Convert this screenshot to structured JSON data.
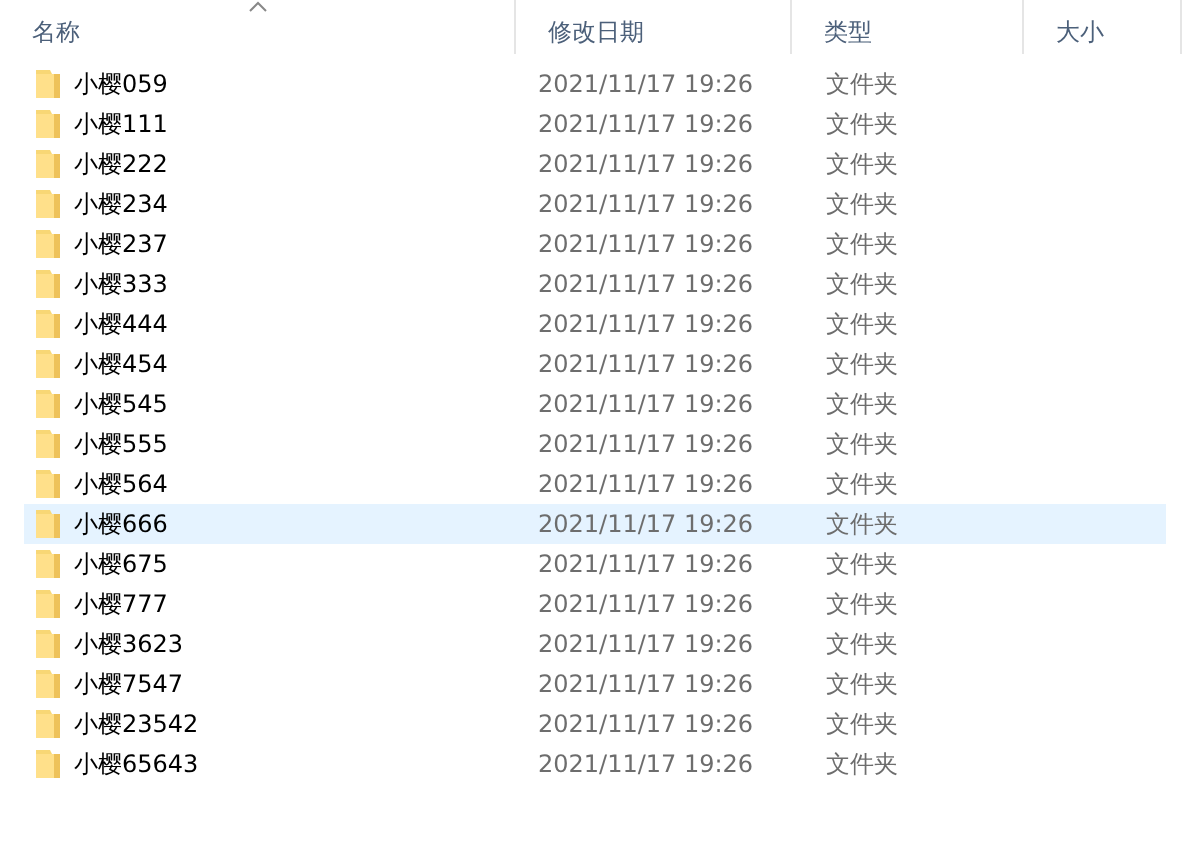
{
  "columns": [
    {
      "label": "名称",
      "sorted": true
    },
    {
      "label": "修改日期",
      "sorted": false
    },
    {
      "label": "类型",
      "sorted": false
    },
    {
      "label": "大小",
      "sorted": false
    }
  ],
  "rows": [
    {
      "name": "小樱059",
      "modified": "2021/11/17 19:26",
      "type": "文件夹",
      "hovered": false
    },
    {
      "name": "小樱111",
      "modified": "2021/11/17 19:26",
      "type": "文件夹",
      "hovered": false
    },
    {
      "name": "小樱222",
      "modified": "2021/11/17 19:26",
      "type": "文件夹",
      "hovered": false
    },
    {
      "name": "小樱234",
      "modified": "2021/11/17 19:26",
      "type": "文件夹",
      "hovered": false
    },
    {
      "name": "小樱237",
      "modified": "2021/11/17 19:26",
      "type": "文件夹",
      "hovered": false
    },
    {
      "name": "小樱333",
      "modified": "2021/11/17 19:26",
      "type": "文件夹",
      "hovered": false
    },
    {
      "name": "小樱444",
      "modified": "2021/11/17 19:26",
      "type": "文件夹",
      "hovered": false
    },
    {
      "name": "小樱454",
      "modified": "2021/11/17 19:26",
      "type": "文件夹",
      "hovered": false
    },
    {
      "name": "小樱545",
      "modified": "2021/11/17 19:26",
      "type": "文件夹",
      "hovered": false
    },
    {
      "name": "小樱555",
      "modified": "2021/11/17 19:26",
      "type": "文件夹",
      "hovered": false
    },
    {
      "name": "小樱564",
      "modified": "2021/11/17 19:26",
      "type": "文件夹",
      "hovered": false
    },
    {
      "name": "小樱666",
      "modified": "2021/11/17 19:26",
      "type": "文件夹",
      "hovered": true
    },
    {
      "name": "小樱675",
      "modified": "2021/11/17 19:26",
      "type": "文件夹",
      "hovered": false
    },
    {
      "name": "小樱777",
      "modified": "2021/11/17 19:26",
      "type": "文件夹",
      "hovered": false
    },
    {
      "name": "小樱3623",
      "modified": "2021/11/17 19:26",
      "type": "文件夹",
      "hovered": false
    },
    {
      "name": "小樱7547",
      "modified": "2021/11/17 19:26",
      "type": "文件夹",
      "hovered": false
    },
    {
      "name": "小樱23542",
      "modified": "2021/11/17 19:26",
      "type": "文件夹",
      "hovered": false
    },
    {
      "name": "小樱65643",
      "modified": "2021/11/17 19:26",
      "type": "文件夹",
      "hovered": false
    }
  ]
}
